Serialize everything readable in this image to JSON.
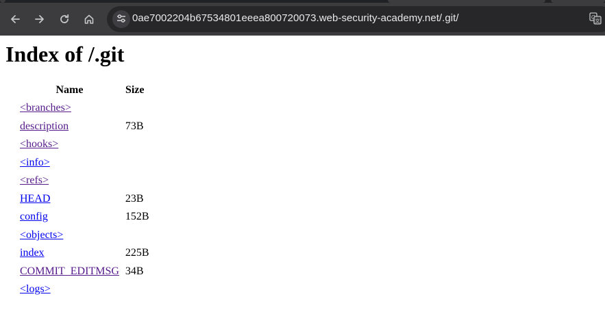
{
  "browser": {
    "url": "0ae7002204b67534801eeea800720073.web-security-academy.net/.git/",
    "back_icon": "arrow-left-icon",
    "forward_icon": "arrow-right-icon",
    "reload_icon": "reload-icon",
    "home_icon": "home-icon",
    "site_info_icon": "tune-icon",
    "translate_icon": "translate-icon"
  },
  "page": {
    "title": "Index of /.git",
    "columns": {
      "name": "Name",
      "size": "Size"
    },
    "entries": [
      {
        "name": "<branches>",
        "size": "",
        "visited": true
      },
      {
        "name": "description",
        "size": "73B",
        "visited": true
      },
      {
        "name": "<hooks>",
        "size": "",
        "visited": true
      },
      {
        "name": "<info>",
        "size": "",
        "visited": false
      },
      {
        "name": "<refs>",
        "size": "",
        "visited": true
      },
      {
        "name": "HEAD",
        "size": "23B",
        "visited": false
      },
      {
        "name": "config",
        "size": "152B",
        "visited": false
      },
      {
        "name": "<objects>",
        "size": "",
        "visited": false
      },
      {
        "name": "index",
        "size": "225B",
        "visited": false
      },
      {
        "name": "COMMIT_EDITMSG",
        "size": "34B",
        "visited": true
      },
      {
        "name": "<logs>",
        "size": "",
        "visited": false
      }
    ]
  },
  "colors": {
    "link": "#0000ee",
    "visited_link": "#551a8b",
    "toolbar": "#3c3c3f",
    "omnibox": "#27272a"
  }
}
